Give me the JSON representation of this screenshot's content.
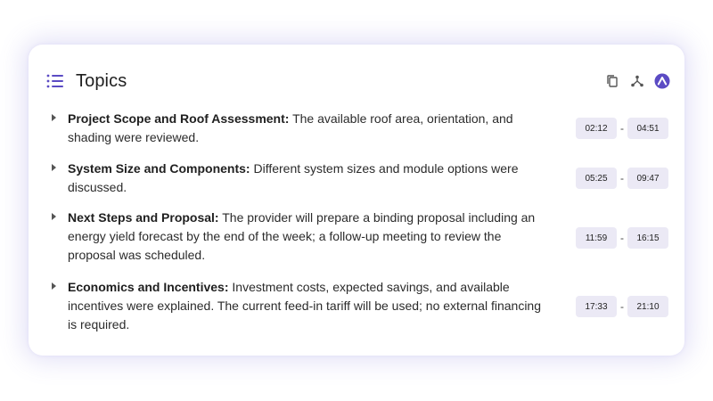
{
  "header": {
    "title": "Topics",
    "list_icon": "list-icon",
    "actions": [
      {
        "name": "copy-icon"
      },
      {
        "name": "share-icon"
      },
      {
        "name": "collapse-icon"
      }
    ],
    "accent_color": "#5b4bc4"
  },
  "topics": [
    {
      "title": "Project Scope and Roof Assessment:",
      "text": " The available roof area, orientation, and shading were reviewed.",
      "start": "02:12",
      "end": "04:51"
    },
    {
      "title": "System Size and Components:",
      "text": " Different system sizes and module options were discussed.",
      "start": "05:25",
      "end": "09:47"
    },
    {
      "title": "Next Steps and Proposal:",
      "text": " The provider will prepare a binding proposal including an energy yield forecast by the end of the week; a follow-up meeting to review the proposal was scheduled.",
      "start": "11:59",
      "end": "16:15"
    },
    {
      "title": "Economics and Incentives:",
      "text": " Investment costs, expected savings, and available incentives were explained. The current feed-in tariff will be used; no external financing is required.",
      "start": "17:33",
      "end": "21:10"
    }
  ],
  "separator": "-"
}
